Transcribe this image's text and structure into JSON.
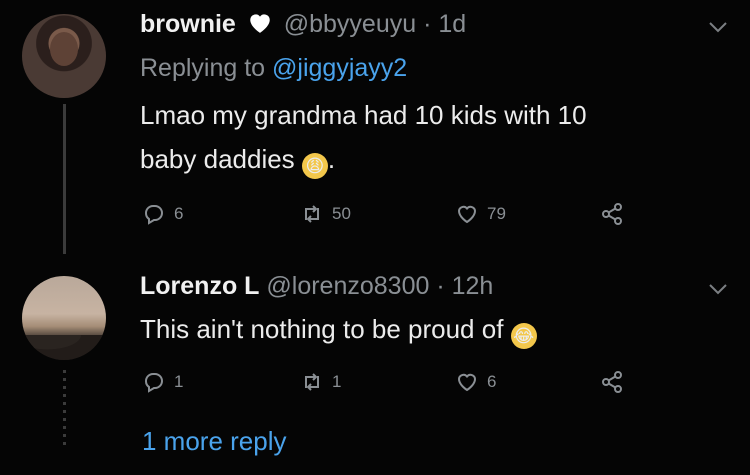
{
  "tweets": [
    {
      "display_name": "brownie",
      "heart": "♡",
      "handle": "@bbyyeuyu",
      "time": "1d",
      "replying_prefix": "Replying to",
      "replying_to": "@jiggyjayy2",
      "text_line1": "Lmao my grandma had 10 kids with 10",
      "text_line2": "baby daddies",
      "emoji_name": "weary-face-emoji",
      "text_suffix": ".",
      "replies": "6",
      "retweets": "50",
      "likes": "79"
    },
    {
      "display_name": "Lorenzo L",
      "handle": "@lorenzo8300",
      "time": "12h",
      "text_line1": "This ain't nothing to be proud of",
      "emoji_name": "tears-of-joy-emoji",
      "replies": "1",
      "retweets": "1",
      "likes": "6"
    }
  ],
  "more_replies": "1 more reply",
  "colors": {
    "background": "#050505",
    "link": "#4aa3ec",
    "muted": "#8a8f94"
  }
}
